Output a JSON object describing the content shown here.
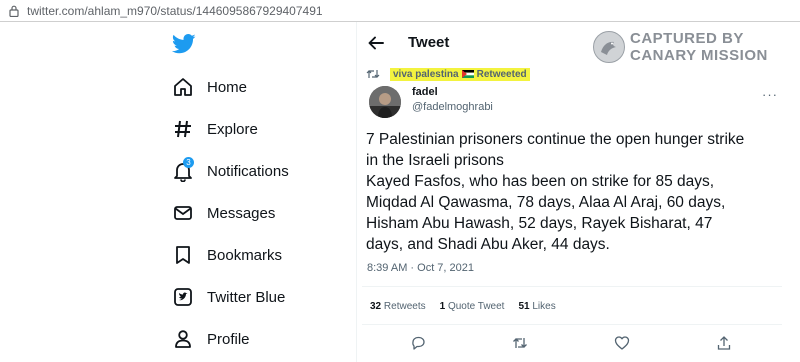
{
  "browser": {
    "url": "twitter.com/ahlam_m970/status/1446095867929407491"
  },
  "nav": {
    "items": [
      {
        "label": "Home",
        "icon": "home-icon"
      },
      {
        "label": "Explore",
        "icon": "hashtag-icon"
      },
      {
        "label": "Notifications",
        "icon": "bell-icon",
        "badge": "3"
      },
      {
        "label": "Messages",
        "icon": "envelope-icon"
      },
      {
        "label": "Bookmarks",
        "icon": "bookmark-icon"
      },
      {
        "label": "Twitter Blue",
        "icon": "twitter-blue-icon"
      },
      {
        "label": "Profile",
        "icon": "person-icon"
      }
    ]
  },
  "header": {
    "title": "Tweet"
  },
  "watermark": {
    "line1": "CAPTURED BY",
    "line2": "CANARY MISSION"
  },
  "retweet": {
    "retweeter": "viva palestina",
    "suffix": "Retweeted",
    "highlight_color": "#f3f33f"
  },
  "tweet": {
    "author_name": "fadel",
    "author_handle": "@fadelmoghrabi",
    "more": "···",
    "lines": [
      "7 Palestinian prisoners continue the open hunger strike",
      "in the Israeli prisons",
      "Kayed Fasfos, who has been on strike for 85 days,",
      "Miqdad Al Qawasma, 78 days, Alaa Al Araj, 60 days,",
      "Hisham Abu Hawash, 52 days, Rayek Bisharat, 47",
      "days, and Shadi Abu Aker, 44 days."
    ],
    "timestamp": "8:39 AM · Oct 7, 2021"
  },
  "stats": {
    "retweets_count": "32",
    "retweets_label": "Retweets",
    "quotes_count": "1",
    "quotes_label": "Quote Tweet",
    "likes_count": "51",
    "likes_label": "Likes"
  },
  "colors": {
    "accent": "#1d9bf0",
    "muted": "#536471",
    "text": "#0f1419"
  }
}
